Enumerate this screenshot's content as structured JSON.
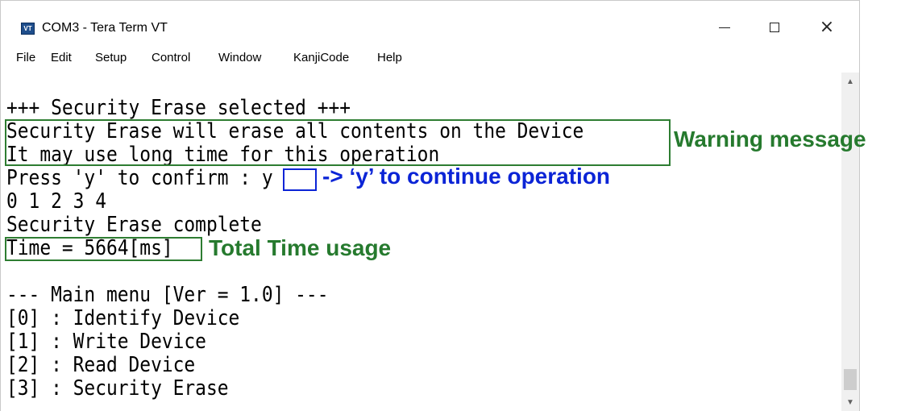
{
  "window": {
    "title": "COM3 - Tera Term VT",
    "icon_label": "VT",
    "menu": [
      {
        "key": "F",
        "rest": "ile"
      },
      {
        "key": "E",
        "rest": "dit"
      },
      {
        "key": "S",
        "rest": "etup"
      },
      {
        "key": "C",
        "rest": "ontrol",
        "pre": "",
        "special": "Control"
      },
      {
        "key": "W",
        "rest": "indow"
      },
      {
        "key": "K",
        "rest": "anjiCode"
      },
      {
        "key": "H",
        "rest": "elp"
      }
    ],
    "menu_labels": [
      "File",
      "Edit",
      "Setup",
      "Control",
      "Window",
      "KanjiCode",
      "Help"
    ],
    "controls": {
      "minimize": "minimize",
      "maximize": "maximize",
      "close": "×"
    }
  },
  "terminal": {
    "lines": [
      "+++ Security Erase selected +++",
      "Security Erase will erase all contents on the Device",
      "It may use long time for this operation",
      "Press 'y' to confirm : y",
      "0 1 2 3 4",
      "Security Erase complete",
      "Time = 5664[ms]",
      "",
      "--- Main menu [Ver = 1.0] ---",
      "[0] : Identify Device",
      "[1] : Write Device",
      "[2] : Read Device",
      "[3] : Security Erase"
    ]
  },
  "annotations": {
    "warning": "Warning message",
    "continue": "-> ‘y’ to continue operation",
    "total_time": "Total Time usage"
  },
  "colors": {
    "annotation_green": "#267a2e",
    "annotation_blue": "#0b24d6"
  }
}
